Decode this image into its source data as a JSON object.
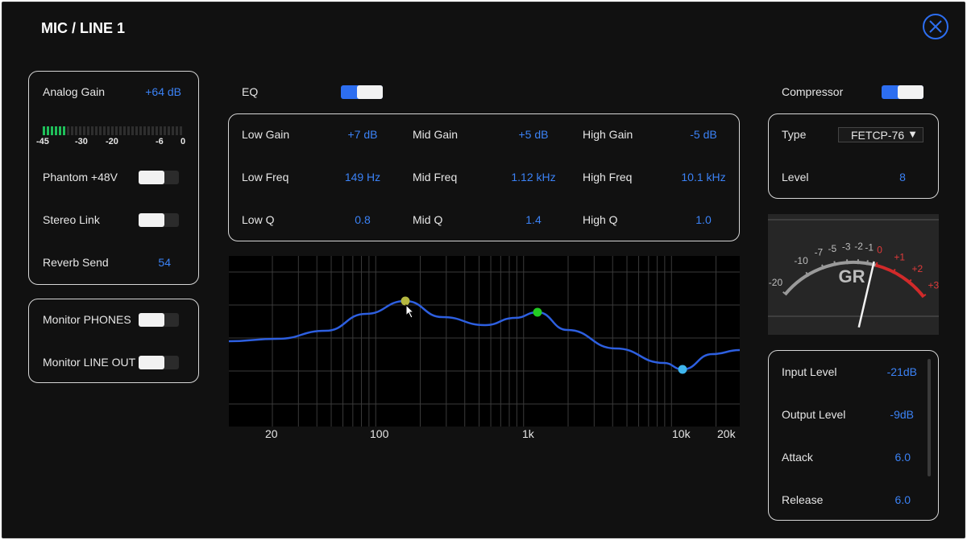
{
  "title": "MIC / LINE 1",
  "close_icon": "close-circle-icon",
  "input": {
    "analog_gain_label": "Analog Gain",
    "analog_gain_value": "+64 dB",
    "meter_ticks": [
      "-45",
      "-30",
      "-20",
      "-6",
      "0"
    ],
    "meter_level_segments_lit": 6,
    "phantom_label": "Phantom +48V",
    "phantom_on": false,
    "stereo_link_label": "Stereo Link",
    "stereo_link_on": false,
    "reverb_send_label": "Reverb Send",
    "reverb_send_value": "54"
  },
  "monitor": {
    "phones_label": "Monitor PHONES",
    "phones_on": false,
    "line_out_label": "Monitor LINE OUT",
    "line_out_on": false
  },
  "eq": {
    "label": "EQ",
    "enabled": true,
    "low_gain_label": "Low Gain",
    "low_gain_value": "+7 dB",
    "mid_gain_label": "Mid Gain",
    "mid_gain_value": "+5 dB",
    "high_gain_label": "High Gain",
    "high_gain_value": "-5 dB",
    "low_freq_label": "Low Freq",
    "low_freq_value": "149 Hz",
    "mid_freq_label": "Mid Freq",
    "mid_freq_value": "1.12 kHz",
    "high_freq_label": "High Freq",
    "high_freq_value": "10.1 kHz",
    "low_q_label": "Low Q",
    "low_q_value": "0.8",
    "mid_q_label": "Mid Q",
    "mid_q_value": "1.4",
    "high_q_label": "High Q",
    "high_q_value": "1.0",
    "freq_axis": [
      "20",
      "100",
      "1k",
      "10k",
      "20k"
    ],
    "band_colors": {
      "low": "#b5b840",
      "mid": "#22cc22",
      "high": "#3fb6ee"
    },
    "curve_color": "#2d5fe0"
  },
  "compressor": {
    "label": "Compressor",
    "enabled": true,
    "type_label": "Type",
    "type_value": "FETCP-76",
    "level_label": "Level",
    "level_value": "8",
    "gr_meter": {
      "label": "GR",
      "ticks_white": [
        "-20",
        "-10",
        "-7",
        "-5",
        "-3",
        "-2",
        "-1"
      ],
      "ticks_red": [
        "0",
        "+1",
        "+2",
        "+3"
      ]
    },
    "input_level_label": "Input Level",
    "input_level_value": "-21dB",
    "output_level_label": "Output Level",
    "output_level_value": "-9dB",
    "attack_label": "Attack",
    "attack_value": "6.0",
    "release_label": "Release",
    "release_value": "6.0"
  }
}
